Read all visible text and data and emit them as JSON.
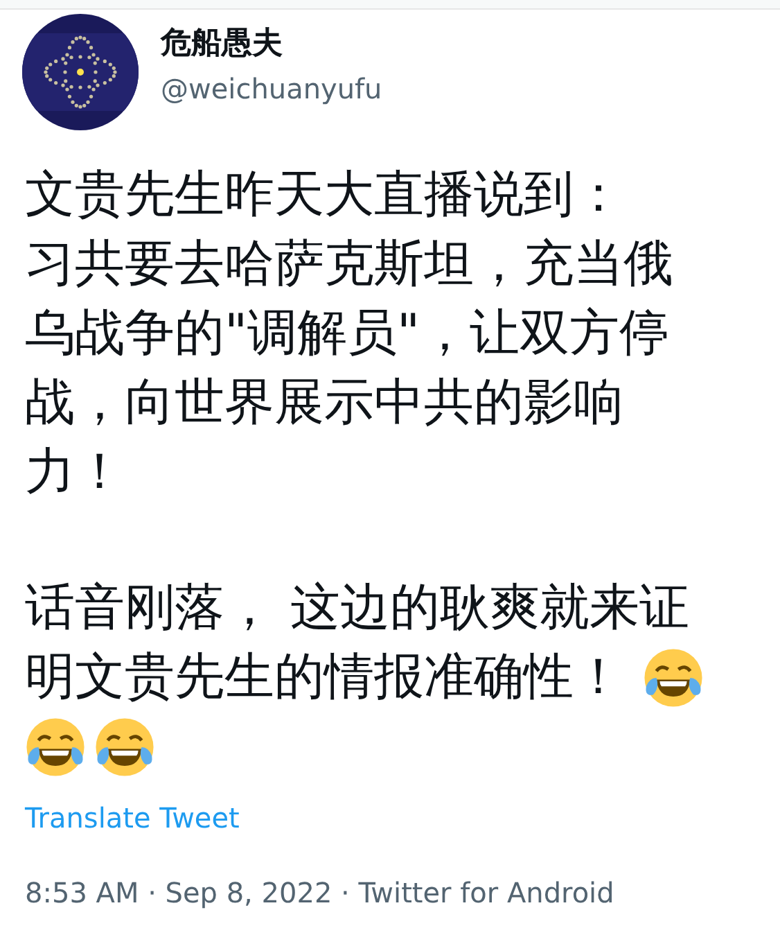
{
  "author": {
    "name": "危船愚夫",
    "handle": "@weichuanyufu"
  },
  "paragraphs": [
    {
      "lines": [
        {
          "text": "文贵先生昨天大直播说到："
        },
        {
          "text": "习共要去哈萨克斯坦，充当俄"
        },
        {
          "text": "乌战争的\"调解员\"，让双方停"
        },
        {
          "text": "战，向世界展示中共的影响"
        },
        {
          "text": "力！"
        }
      ]
    },
    {
      "lines": [
        {
          "text": "话音刚落， 这边的耿爽就来证"
        },
        {
          "text": "明文贵先生的情报准确性！",
          "emojis": [
            {
              "kind": "tears-of-joy"
            }
          ]
        },
        {
          "emojis": [
            {
              "kind": "tears-of-joy"
            },
            {
              "kind": "tears-of-joy"
            }
          ]
        }
      ]
    }
  ],
  "translate_link": "Translate Tweet",
  "meta": "8:53 AM · Sep 8, 2022 · Twitter for Android"
}
